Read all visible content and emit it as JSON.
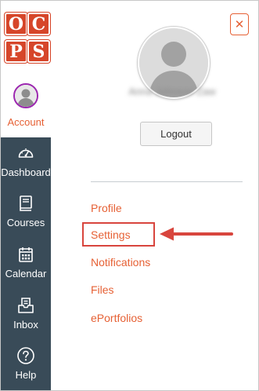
{
  "logo": {
    "letters": [
      "O",
      "C",
      "P",
      "S"
    ]
  },
  "nav": {
    "account_label": "Account",
    "items": [
      {
        "label": "Dashboard",
        "icon": "dashboard-icon"
      },
      {
        "label": "Courses",
        "icon": "courses-icon"
      },
      {
        "label": "Calendar",
        "icon": "calendar-icon"
      },
      {
        "label": "Inbox",
        "icon": "inbox-icon"
      },
      {
        "label": "Help",
        "icon": "help-icon"
      }
    ]
  },
  "tray": {
    "close_glyph": "✕",
    "user_name": "Anna Johnson Zaw",
    "logout_label": "Logout",
    "links": [
      {
        "label": "Profile"
      },
      {
        "label": "Settings"
      },
      {
        "label": "Notifications"
      },
      {
        "label": "Files"
      },
      {
        "label": "ePortfolios"
      }
    ]
  },
  "colors": {
    "nav_background": "#394b58",
    "link": "#e66135",
    "logo_block": "#d6462a",
    "highlight": "#d8453d"
  }
}
